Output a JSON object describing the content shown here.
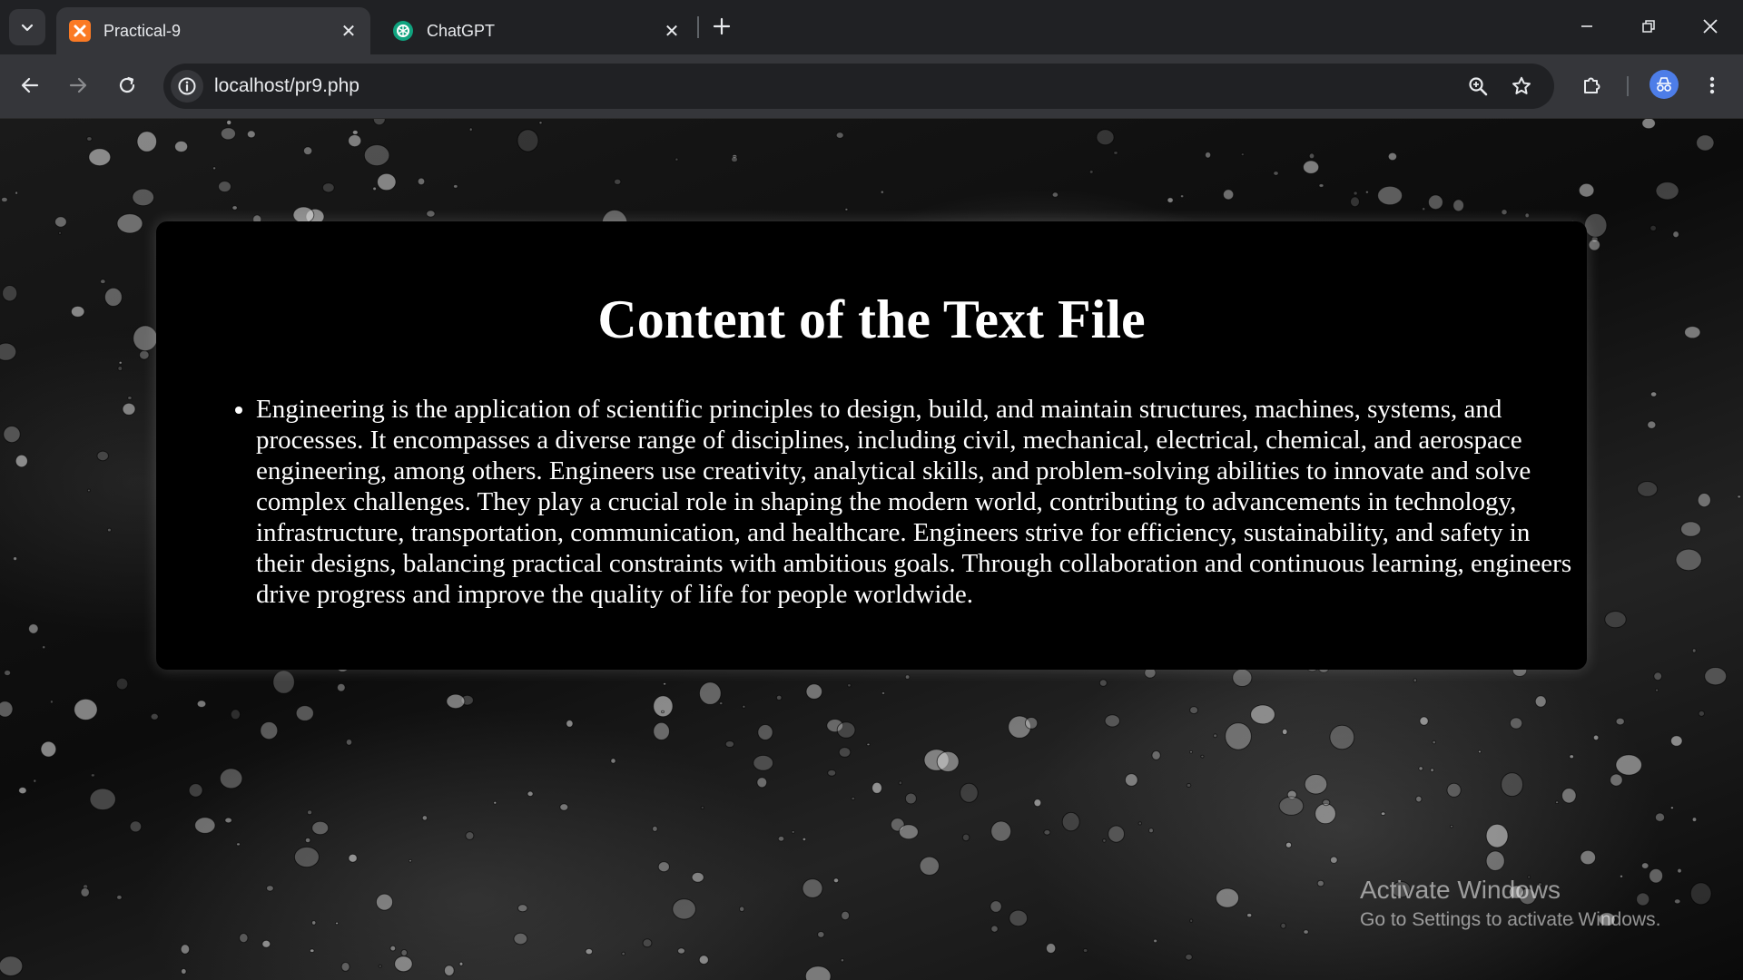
{
  "browser": {
    "tabs": [
      {
        "title": "Practical-9",
        "active": true,
        "favicon": "xampp-icon",
        "favicon_color": "#fb7a24"
      },
      {
        "title": "ChatGPT",
        "active": false,
        "favicon": "chatgpt-icon",
        "favicon_color": "#10a37f"
      }
    ],
    "address": "localhost/pr9.php",
    "theme_colors": {
      "tabstrip": "#202124",
      "toolbar": "#35363a",
      "avatar": "#4d7de8"
    }
  },
  "page": {
    "heading": "Content of the Text File",
    "items": [
      "Engineering is the application of scientific principles to design, build, and maintain structures, machines, systems, and processes. It encompasses a diverse range of disciplines, including civil, mechanical, electrical, chemical, and aerospace engineering, among others. Engineers use creativity, analytical skills, and problem-solving abilities to innovate and solve complex challenges. They play a crucial role in shaping the modern world, contributing to advancements in technology, infrastructure, transportation, communication, and healthcare. Engineers strive for efficiency, sustainability, and safety in their designs, balancing practical constraints with ambitious goals. Through collaboration and continuous learning, engineers drive progress and improve the quality of life for people worldwide."
    ],
    "background": "rain-drops-on-glass"
  },
  "watermark": {
    "title": "Activate Windows",
    "subtitle": "Go to Settings to activate Windows."
  }
}
